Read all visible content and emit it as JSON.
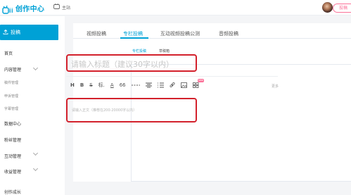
{
  "header": {
    "logo_text": "创作中心",
    "home_link": "主站",
    "contribute_btn": "投稿"
  },
  "sidebar": {
    "submit_label": "投稿",
    "items": [
      {
        "label": "首页"
      },
      {
        "label": "内容管理"
      },
      {
        "label": "稿件管理"
      },
      {
        "label": "申诉管理"
      },
      {
        "label": "字幕管理"
      },
      {
        "label": "数据中心"
      },
      {
        "label": "粉丝管理"
      },
      {
        "label": "互动管理"
      },
      {
        "label": "收益管理"
      },
      {
        "label": "创作成长"
      }
    ]
  },
  "main": {
    "tabs": [
      {
        "label": "视频投稿"
      },
      {
        "label": "专栏投稿"
      },
      {
        "label": "互动视频投稿公测"
      },
      {
        "label": "音频投稿"
      }
    ],
    "subtabs": [
      {
        "label": "专栏投稿"
      },
      {
        "label": "草稿箱"
      }
    ],
    "title_placeholder": "请输入标题（建议30字以内）",
    "content_placeholder": "请输入正文（推荐在200-20000字以内）",
    "toolbar": {
      "h": "H",
      "b": "B",
      "s": "S",
      "mark": "标.",
      "a": "A",
      "quote": "66",
      "new_badge": "new",
      "more": "更多"
    }
  },
  "colors": {
    "accent": "#00a1d6",
    "pink": "#fb7299",
    "highlight_box": "#d3212c"
  }
}
